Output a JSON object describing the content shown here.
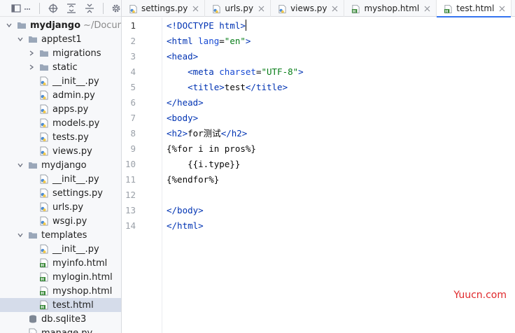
{
  "sidebar": {
    "tree": [
      {
        "label": "mydjango",
        "path": "~/Documen",
        "indent": 0,
        "expanded": true,
        "icon": "folder-icon",
        "bold": true
      },
      {
        "label": "apptest1",
        "indent": 1,
        "expanded": true,
        "icon": "folder-icon"
      },
      {
        "label": "migrations",
        "indent": 2,
        "expanded": false,
        "icon": "folder-icon"
      },
      {
        "label": "static",
        "indent": 2,
        "expanded": false,
        "icon": "folder-icon"
      },
      {
        "label": "__init__.py",
        "indent": 2,
        "icon": "python-file-icon"
      },
      {
        "label": "admin.py",
        "indent": 2,
        "icon": "python-file-icon"
      },
      {
        "label": "apps.py",
        "indent": 2,
        "icon": "python-file-icon"
      },
      {
        "label": "models.py",
        "indent": 2,
        "icon": "python-file-icon"
      },
      {
        "label": "tests.py",
        "indent": 2,
        "icon": "python-file-icon"
      },
      {
        "label": "views.py",
        "indent": 2,
        "icon": "python-file-icon"
      },
      {
        "label": "mydjango",
        "indent": 1,
        "expanded": true,
        "icon": "folder-icon"
      },
      {
        "label": "__init__.py",
        "indent": 2,
        "icon": "python-file-icon"
      },
      {
        "label": "settings.py",
        "indent": 2,
        "icon": "python-file-icon"
      },
      {
        "label": "urls.py",
        "indent": 2,
        "icon": "python-file-icon"
      },
      {
        "label": "wsgi.py",
        "indent": 2,
        "icon": "python-file-icon"
      },
      {
        "label": "templates",
        "indent": 1,
        "expanded": true,
        "icon": "folder-icon"
      },
      {
        "label": "__init__.py",
        "indent": 2,
        "icon": "python-file-icon"
      },
      {
        "label": "myinfo.html",
        "indent": 2,
        "icon": "html-file-icon"
      },
      {
        "label": "mylogin.html",
        "indent": 2,
        "icon": "html-file-icon"
      },
      {
        "label": "myshop.html",
        "indent": 2,
        "icon": "html-file-icon"
      },
      {
        "label": "test.html",
        "indent": 2,
        "icon": "html-file-icon",
        "selected": true
      },
      {
        "label": "db.sqlite3",
        "indent": 1,
        "icon": "database-file-icon"
      },
      {
        "label": "manage.py",
        "indent": 1,
        "icon": "python-file-icon"
      }
    ]
  },
  "tabs": [
    {
      "label": "settings.py",
      "icon": "python-file-icon",
      "active": false
    },
    {
      "label": "urls.py",
      "icon": "python-file-icon",
      "active": false
    },
    {
      "label": "views.py",
      "icon": "python-file-icon",
      "active": false
    },
    {
      "label": "myshop.html",
      "icon": "html-file-icon",
      "active": false
    },
    {
      "label": "test.html",
      "icon": "html-file-icon",
      "active": true
    }
  ],
  "editor": {
    "current_line": 1,
    "lines": [
      [
        [
          "t",
          "<!DOCTYPE "
        ],
        [
          "t",
          "html"
        ],
        [
          "t",
          ">"
        ]
      ],
      [
        [
          "t",
          "<html "
        ],
        [
          "a",
          "lang"
        ],
        [
          "p",
          "="
        ],
        [
          "v",
          "\"en\""
        ],
        [
          "t",
          ">"
        ]
      ],
      [
        [
          "t",
          "<head>"
        ]
      ],
      [
        [
          "p",
          "    "
        ],
        [
          "t",
          "<meta "
        ],
        [
          "a",
          "charset"
        ],
        [
          "p",
          "="
        ],
        [
          "v",
          "\"UTF-8\""
        ],
        [
          "t",
          ">"
        ]
      ],
      [
        [
          "p",
          "    "
        ],
        [
          "t",
          "<title>"
        ],
        [
          "p",
          "test"
        ],
        [
          "t",
          "</title>"
        ]
      ],
      [
        [
          "t",
          "</head>"
        ]
      ],
      [
        [
          "t",
          "<body>"
        ]
      ],
      [
        [
          "t",
          "<h2>"
        ],
        [
          "p",
          "for测试"
        ],
        [
          "t",
          "</h2>"
        ]
      ],
      [
        [
          "p",
          "{%for i in pros%}"
        ]
      ],
      [
        [
          "p",
          "    {{i.type}}"
        ]
      ],
      [
        [
          "p",
          "{%endfor%}"
        ]
      ],
      [
        [
          "p",
          ""
        ]
      ],
      [
        [
          "t",
          "</body>"
        ]
      ],
      [
        [
          "t",
          "</html>"
        ]
      ]
    ]
  },
  "watermark": "Yuucn.com",
  "colors": {
    "accent": "#3574f0",
    "selection": "#d5dcea",
    "tag": "#0033b3",
    "attr": "#174ad4",
    "string": "#067d17",
    "watermark": "#e0282b"
  }
}
